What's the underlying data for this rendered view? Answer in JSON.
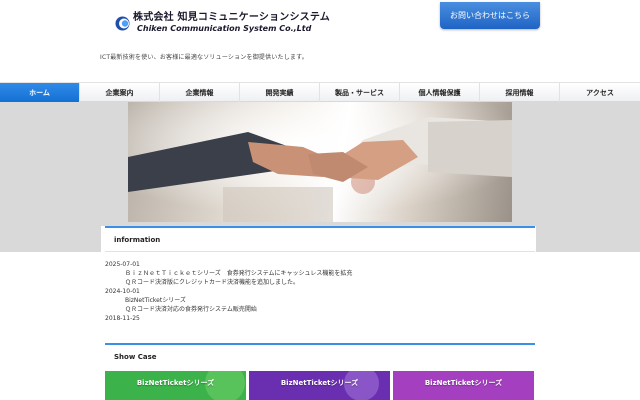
{
  "header": {
    "company_jp": "株式会社 知見コミュニケーションシステム",
    "company_en": "Chiken Communication System Co.,Ltd",
    "tagline": "ICT最新技術を使い、お客様に最適なソリューションを御提供いたします。",
    "contact_label": "お問い合わせはこちら",
    "accent_color": "#1f64c4"
  },
  "nav": {
    "items": [
      {
        "label": "ホーム",
        "active": true
      },
      {
        "label": "企業案内"
      },
      {
        "label": "企業情報"
      },
      {
        "label": "開発実績"
      },
      {
        "label": "製品・サービス"
      },
      {
        "label": "個人情報保護"
      },
      {
        "label": "採用情報"
      },
      {
        "label": "アクセス"
      }
    ]
  },
  "information": {
    "title": "information",
    "entries": [
      {
        "date": "2025-07-01",
        "lines": [
          "ＢｉｚＮｅｔＴｉｃｋｅｔシリーズ　食券発行システムにキャッシュレス機能を拡充",
          "ＱＲコード決済版にクレジットカード決済機能を追加しました。"
        ]
      },
      {
        "date": "2024-10-01",
        "lines": [
          "BizNetTicketシリーズ",
          "ＱＲコード決済対応の食券発行システム販売開始"
        ]
      },
      {
        "date": "2018-11-25",
        "lines": []
      }
    ]
  },
  "showcase": {
    "title": "Show Case",
    "cards": [
      {
        "label": "BizNetTicketシリーズ",
        "color": "#3bb34a"
      },
      {
        "label": "BizNetTicketシリーズ",
        "color": "#6a2fb0"
      },
      {
        "label": "BizNetTicketシリーズ",
        "color": "#a43fc0"
      }
    ]
  }
}
